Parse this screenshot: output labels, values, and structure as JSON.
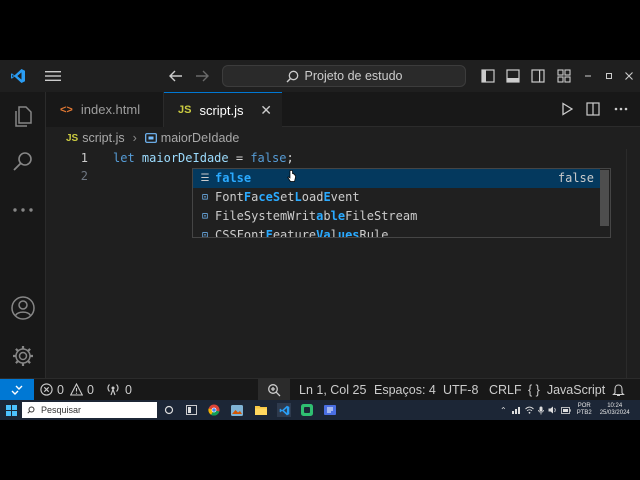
{
  "titlebar": {
    "search_text": "Projeto de estudo"
  },
  "tabs": [
    {
      "label": "index.html",
      "icon": "html-file-icon",
      "icon_glyph": "<>",
      "active": false
    },
    {
      "label": "script.js",
      "icon": "js-file-icon",
      "icon_glyph": "JS",
      "active": true
    }
  ],
  "breadcrumb": {
    "file_icon": "JS",
    "file": "script.js",
    "symbol": "maiorDeIdade"
  },
  "editor": {
    "lines": [
      {
        "number": "1",
        "tokens": {
          "keyword": "let",
          "variable": "maiorDeIdade",
          "operator": "=",
          "value": "false",
          "end": ";"
        }
      },
      {
        "number": "2"
      }
    ]
  },
  "suggestions": [
    {
      "label_parts": [
        {
          "t": "false",
          "h": true
        }
      ],
      "detail": "false",
      "icon": "keyword-icon",
      "selected": true
    },
    {
      "label_parts": [
        {
          "t": "Font",
          "h": false
        },
        {
          "t": "F",
          "h": true
        },
        {
          "t": "a",
          "h": false
        },
        {
          "t": "ce",
          "h": true
        },
        {
          "t": "S",
          "h": true
        },
        {
          "t": "et",
          "h": false
        },
        {
          "t": "L",
          "h": true
        },
        {
          "t": "oad",
          "h": false
        },
        {
          "t": "E",
          "h": true
        },
        {
          "t": "vent",
          "h": false
        }
      ],
      "detail": "",
      "icon": "variable-icon",
      "selected": false
    },
    {
      "label_parts": [
        {
          "t": "FileSystemWrit",
          "h": false
        },
        {
          "t": "a",
          "h": true
        },
        {
          "t": "b",
          "h": false
        },
        {
          "t": "le",
          "h": true
        },
        {
          "t": "FileS",
          "h": false
        },
        {
          "t": "tream",
          "h": false
        }
      ],
      "detail": "",
      "icon": "variable-icon",
      "selected": false
    },
    {
      "label_parts": [
        {
          "t": "CSSFont",
          "h": false
        },
        {
          "t": "F",
          "h": true
        },
        {
          "t": "eature",
          "h": false
        },
        {
          "t": "Va",
          "h": true
        },
        {
          "t": "l",
          "h": false
        },
        {
          "t": "ues",
          "h": true
        },
        {
          "t": "Rule",
          "h": false
        }
      ],
      "detail": "",
      "icon": "variable-icon",
      "selected": false
    }
  ],
  "statusbar": {
    "errors": "0",
    "warnings": "0",
    "ports": "0",
    "position": "Ln 1, Col 25",
    "spaces": "Espaços: 4",
    "encoding": "UTF-8",
    "eol": "CRLF",
    "language": "JavaScript"
  },
  "taskbar": {
    "search_placeholder": "Pesquisar",
    "lang_top": "POR",
    "lang_bottom": "PTB2",
    "time": "10:24",
    "date": "25/03/2024"
  },
  "colors": {
    "accent": "#0078d4",
    "keyword": "#569cd6",
    "variable": "#9cdcfe",
    "highlight": "#2aaaff",
    "selection": "#04395e"
  }
}
